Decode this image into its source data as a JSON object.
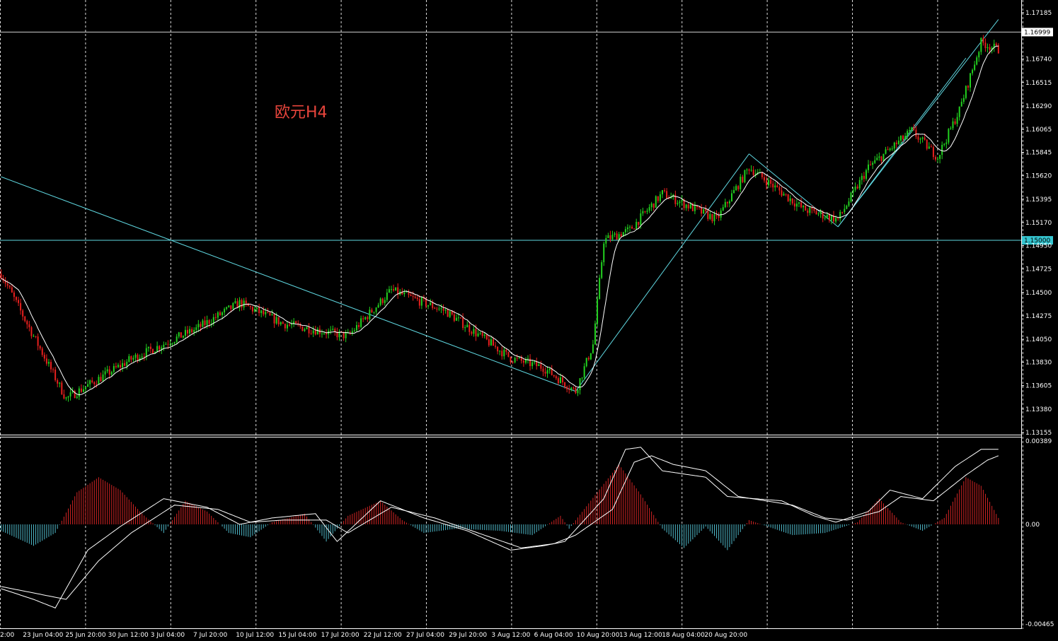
{
  "colors": {
    "background": "#000000",
    "bull": "#22d11f",
    "bear": "#e8201e",
    "ma": "#ffffff",
    "trendline": "#5fd7e0",
    "grid": "#ffffff",
    "hist_pos": "#d22424",
    "hist_neg": "#4fb8c8",
    "title": "#e8453c",
    "current_price_label_bg": "#ffffff",
    "level_label_bg": "#35c5d0"
  },
  "chart_data": [
    {
      "type": "candlestick",
      "title": "欧元H4",
      "ylim": [
        1.13155,
        1.17185
      ],
      "y_ticks": [
        "1.17185",
        "1.16740",
        "1.16515",
        "1.16290",
        "1.16065",
        "1.15845",
        "1.15620",
        "1.15395",
        "1.15170",
        "1.14950",
        "1.14725",
        "1.14500",
        "1.14275",
        "1.14050",
        "1.13830",
        "1.13605",
        "1.13380",
        "1.13155"
      ],
      "x_ticks": [
        "2:00",
        "23 Jun 04:00",
        "25 Jun 20:00",
        "30 Jun 12:00",
        "3 Jul 04:00",
        "7 Jul 20:00",
        "10 Jul 12:00",
        "15 Jul 04:00",
        "17 Jul 20:00",
        "22 Jul 12:00",
        "27 Jul 04:00",
        "29 Jul 20:00",
        "3 Aug 12:00",
        "6 Aug 04:00",
        "10 Aug 20:00",
        "13 Aug 12:00",
        "18 Aug 04:00",
        "20 Aug 20:00"
      ],
      "current_price": "1.16999",
      "horizontal_levels": [
        "1.15000"
      ],
      "anchors": [
        [
          0,
          1.1468
        ],
        [
          30,
          1.1348
        ],
        [
          60,
          1.1386
        ],
        [
          90,
          1.1415
        ],
        [
          110,
          1.144
        ],
        [
          130,
          1.142
        ],
        [
          160,
          1.1408
        ],
        [
          180,
          1.1452
        ],
        [
          205,
          1.1432
        ],
        [
          235,
          1.1387
        ],
        [
          250,
          1.1378
        ],
        [
          265,
          1.1355
        ],
        [
          273,
          1.14
        ],
        [
          278,
          1.15
        ],
        [
          290,
          1.151
        ],
        [
          305,
          1.1545
        ],
        [
          330,
          1.152
        ],
        [
          345,
          1.157
        ],
        [
          370,
          1.153
        ],
        [
          386,
          1.152
        ],
        [
          400,
          1.157
        ],
        [
          420,
          1.1605
        ],
        [
          432,
          1.158
        ],
        [
          442,
          1.1625
        ],
        [
          452,
          1.169
        ],
        [
          460,
          1.1683
        ]
      ],
      "moving_average": {
        "period": 9
      },
      "trendlines": [
        {
          "from": [
            0,
            1.1561
          ],
          "to": [
            265,
            1.1355
          ]
        },
        {
          "from": [
            265,
            1.1355
          ],
          "to": [
            345,
            1.1583
          ]
        },
        {
          "from": [
            345,
            1.1583
          ],
          "to": [
            386,
            1.1513
          ]
        },
        {
          "from": [
            386,
            1.1513
          ],
          "to": [
            460,
            1.1712
          ]
        },
        {
          "from": [
            386,
            1.1513
          ],
          "to": [
            445,
            1.1675
          ]
        }
      ]
    },
    {
      "type": "macd",
      "ylim": [
        -0.00465,
        0.00389
      ],
      "y_ticks": [
        "0.00389",
        "0.00",
        "-0.00465"
      ],
      "histogram": [
        [
          0,
          -0.0003
        ],
        [
          15,
          -0.001
        ],
        [
          25,
          -0.0004
        ],
        [
          35,
          0.0015
        ],
        [
          45,
          0.0022
        ],
        [
          55,
          0.0016
        ],
        [
          65,
          0.0005
        ],
        [
          75,
          -0.0004
        ],
        [
          85,
          0.0011
        ],
        [
          95,
          0.0006
        ],
        [
          105,
          -0.0004
        ],
        [
          115,
          -0.0006
        ],
        [
          125,
          0.0001
        ],
        [
          140,
          0.0005
        ],
        [
          150,
          -0.0008
        ],
        [
          160,
          0.0004
        ],
        [
          175,
          0.0011
        ],
        [
          185,
          0.0002
        ],
        [
          195,
          -0.0004
        ],
        [
          210,
          -0.0002
        ],
        [
          230,
          -0.0003
        ],
        [
          245,
          -0.0005
        ],
        [
          258,
          0.0004
        ],
        [
          262,
          -0.0002
        ],
        [
          275,
          0.0015
        ],
        [
          285,
          0.0028
        ],
        [
          295,
          0.0014
        ],
        [
          305,
          -0.0002
        ],
        [
          315,
          -0.0011
        ],
        [
          325,
          -0.0001
        ],
        [
          335,
          -0.0012
        ],
        [
          345,
          0.0002
        ],
        [
          365,
          -0.0005
        ],
        [
          380,
          -0.0004
        ],
        [
          395,
          0.0001
        ],
        [
          405,
          0.0012
        ],
        [
          415,
          0.0001
        ],
        [
          425,
          -0.0003
        ],
        [
          435,
          0.0003
        ],
        [
          445,
          0.0022
        ],
        [
          452,
          0.0018
        ],
        [
          460,
          0.0003
        ]
      ],
      "macd_line": [
        [
          0,
          -0.003
        ],
        [
          15,
          -0.0035
        ],
        [
          25,
          -0.0039
        ],
        [
          40,
          -0.0012
        ],
        [
          55,
          -0.0001
        ],
        [
          75,
          0.0012
        ],
        [
          95,
          0.0008
        ],
        [
          110,
          0
        ],
        [
          125,
          0.0003
        ],
        [
          145,
          0.0005
        ],
        [
          155,
          -0.0008
        ],
        [
          175,
          0.0011
        ],
        [
          195,
          0.0003
        ],
        [
          215,
          -0.0003
        ],
        [
          235,
          -0.0012
        ],
        [
          250,
          -0.001
        ],
        [
          260,
          -0.0008
        ],
        [
          278,
          0.0012
        ],
        [
          288,
          0.0035
        ],
        [
          295,
          0.0036
        ],
        [
          305,
          0.0025
        ],
        [
          325,
          0.0022
        ],
        [
          335,
          0.0013
        ],
        [
          360,
          0.0011
        ],
        [
          375,
          0.0004
        ],
        [
          385,
          0.0001
        ],
        [
          400,
          0.0006
        ],
        [
          410,
          0.0016
        ],
        [
          425,
          0.0012
        ],
        [
          440,
          0.0027
        ],
        [
          452,
          0.0035
        ],
        [
          460,
          0.0035
        ]
      ],
      "signal_line": [
        [
          0,
          -0.0029
        ],
        [
          20,
          -0.0033
        ],
        [
          30,
          -0.0035
        ],
        [
          45,
          -0.0017
        ],
        [
          60,
          -0.0004
        ],
        [
          80,
          0.0009
        ],
        [
          100,
          0.0007
        ],
        [
          115,
          0.0001
        ],
        [
          130,
          0.0002
        ],
        [
          150,
          0.0002
        ],
        [
          160,
          -0.0004
        ],
        [
          180,
          0.0008
        ],
        [
          200,
          0.0003
        ],
        [
          220,
          -0.0004
        ],
        [
          240,
          -0.0011
        ],
        [
          255,
          -0.0009
        ],
        [
          265,
          -0.0005
        ],
        [
          282,
          0.0007
        ],
        [
          292,
          0.0029
        ],
        [
          300,
          0.0032
        ],
        [
          310,
          0.0028
        ],
        [
          325,
          0.0025
        ],
        [
          340,
          0.0013
        ],
        [
          365,
          0.0009
        ],
        [
          380,
          0.0003
        ],
        [
          390,
          0.0002
        ],
        [
          405,
          0.0006
        ],
        [
          415,
          0.0013
        ],
        [
          430,
          0.0011
        ],
        [
          445,
          0.0023
        ],
        [
          455,
          0.003
        ],
        [
          460,
          0.0032
        ]
      ]
    }
  ]
}
